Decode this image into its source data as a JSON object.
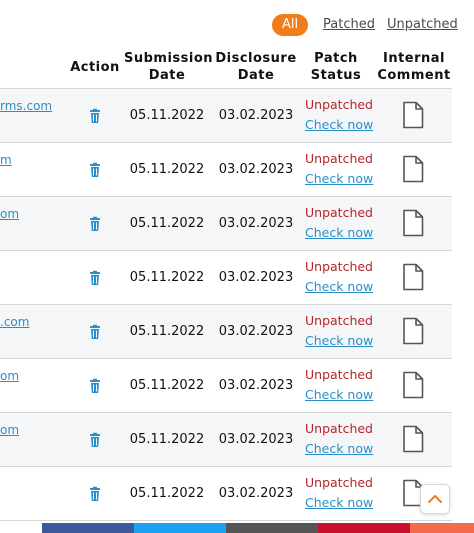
{
  "filters": {
    "all_label": "All",
    "patched_label": "Patched",
    "unpatched_label": "Unpatched"
  },
  "headers": {
    "action": "Action",
    "submission_line1": "Submission",
    "submission_line2": "Date",
    "disclosure_line1": "Disclosure",
    "disclosure_line2": "Date",
    "patch_line1": "Patch",
    "patch_line2": "Status",
    "comment_line1": "Internal",
    "comment_line2": "Comment"
  },
  "rows": [
    {
      "domain": "rms.com",
      "submission": "05.11.2022",
      "disclosure": "03.02.2023",
      "status": "Unpatched",
      "check": "Check now"
    },
    {
      "domain": "m",
      "submission": "05.11.2022",
      "disclosure": "03.02.2023",
      "status": "Unpatched",
      "check": "Check now"
    },
    {
      "domain": "om",
      "submission": "05.11.2022",
      "disclosure": "03.02.2023",
      "status": "Unpatched",
      "check": "Check now"
    },
    {
      "domain": "",
      "submission": "05.11.2022",
      "disclosure": "03.02.2023",
      "status": "Unpatched",
      "check": "Check now"
    },
    {
      "domain": ".com",
      "submission": "05.11.2022",
      "disclosure": "03.02.2023",
      "status": "Unpatched",
      "check": "Check now"
    },
    {
      "domain": "om",
      "submission": "05.11.2022",
      "disclosure": "03.02.2023",
      "status": "Unpatched",
      "check": "Check now"
    },
    {
      "domain": "om",
      "submission": "05.11.2022",
      "disclosure": "03.02.2023",
      "status": "Unpatched",
      "check": "Check now"
    },
    {
      "domain": "",
      "submission": "05.11.2022",
      "disclosure": "03.02.2023",
      "status": "Unpatched",
      "check": "Check now"
    }
  ],
  "icons": {
    "action": "trash-icon",
    "comment": "document-icon",
    "scroll": "chevron-up-icon"
  },
  "colors": {
    "accent": "#ef7d1a",
    "link": "#2a8fc9",
    "unpatched": "#b3262b",
    "bottom_bar": [
      "#3b5998",
      "#1da1f2",
      "#555555",
      "#c8102e",
      "#f26b4f"
    ]
  }
}
